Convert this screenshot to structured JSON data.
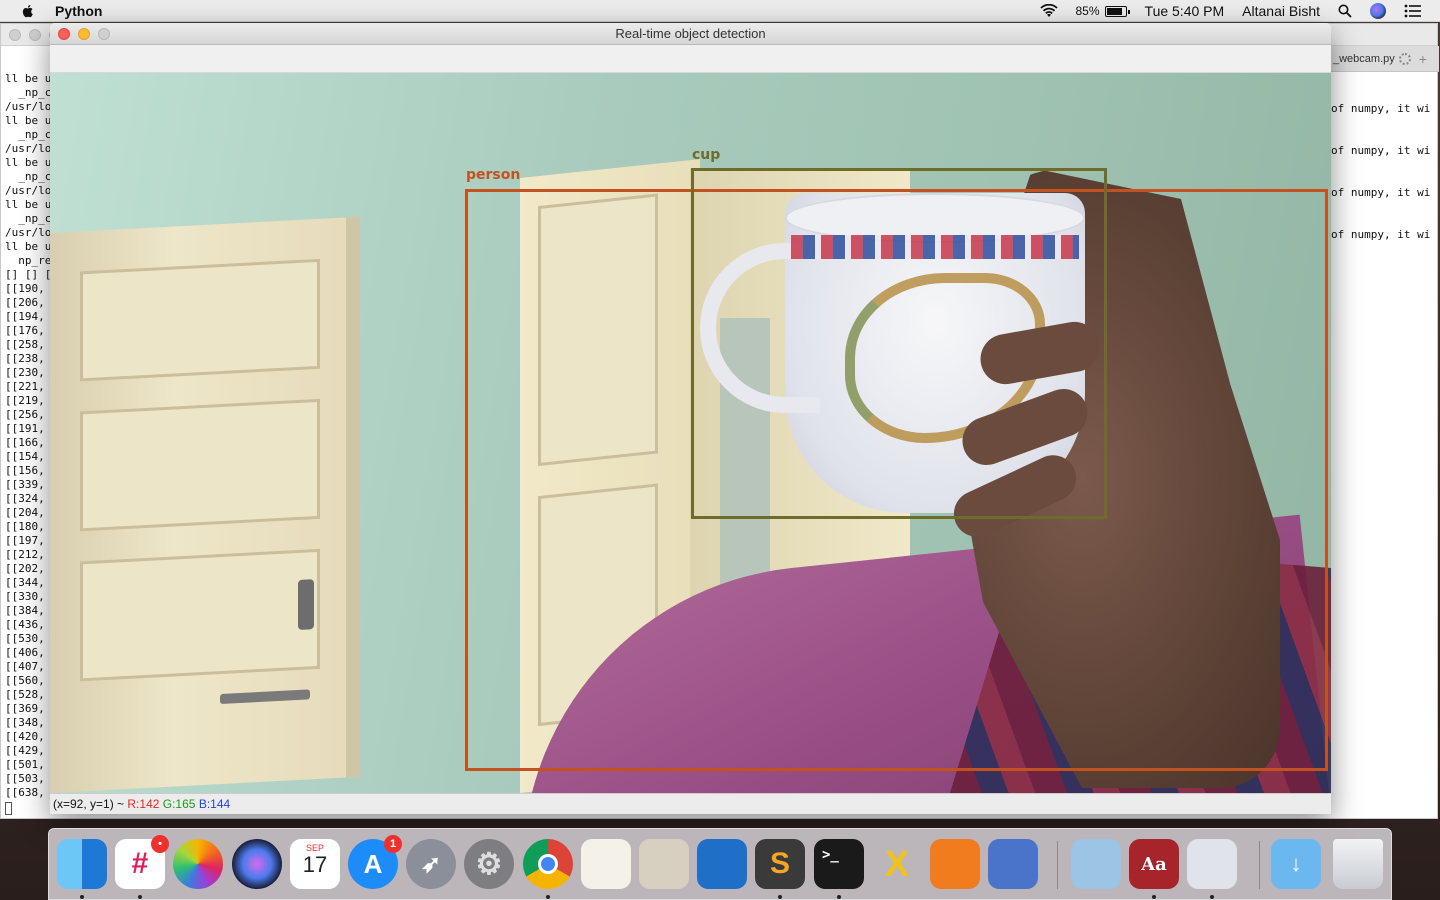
{
  "menubar": {
    "app_name": "Python",
    "battery_percent": "85%",
    "clock": "Tue 5:40 PM",
    "user_name": "Altanai Bisht"
  },
  "terminal": {
    "tab_title": "_webcam.py",
    "left_lines": [
      "ll be u",
      "  _np_c",
      "/usr/lo",
      "ll be u",
      "  _np_c",
      "/usr/lo",
      "ll be u",
      "  _np_c",
      "/usr/lo",
      "ll be u",
      "  _np_c",
      "/usr/lo",
      "ll be u",
      "  np_re",
      "[] [] [",
      "[[190,",
      "[[206,",
      "[[194,",
      "[[176,",
      "[[258,",
      "[[238,",
      "[[230,",
      "[[221,",
      "[[219,",
      "[[256,",
      "[[191,",
      "[[166,",
      "[[154,",
      "[[156,",
      "[[339,",
      "[[324,",
      "[[204,",
      "[[180,",
      "[[197,",
      "[[212,",
      "[[202,",
      "[[344,",
      "[[330,",
      "[[384,",
      "[[436,",
      "[[530,",
      "[[406,",
      "[[407,",
      "[[560,",
      "[[528,",
      "[[369,",
      "[[348,",
      "[[420,",
      "[[429,",
      "[[501,",
      "[[503,",
      "[[638,"
    ],
    "right_lines": [
      "of numpy, it wi",
      "",
      "",
      "of numpy, it wi",
      "",
      "",
      "of numpy, it wi",
      "",
      "",
      "of numpy, it wi"
    ]
  },
  "detection_window": {
    "title": "Real-time object detection",
    "detections": [
      {
        "label": "person",
        "color": "#c4521f"
      },
      {
        "label": "cup",
        "color": "#6f6b2b"
      }
    ],
    "status": {
      "coords": "(x=92, y=1) ~",
      "r": "R:142",
      "g": "G:165",
      "b": "B:144"
    }
  },
  "dock": {
    "items": [
      {
        "name": "Finder",
        "icon": "finder-icon",
        "color": "#3a8ee6",
        "running": true
      },
      {
        "name": "Slack",
        "icon": "slack-icon",
        "color": "#ffffff",
        "running": true,
        "badge": "•"
      },
      {
        "name": "Photos",
        "icon": "photos-icon",
        "color": "#ffffff",
        "running": false
      },
      {
        "name": "Siri",
        "icon": "siri-icon",
        "color": "#1c1c2e",
        "running": false
      },
      {
        "name": "Calendar",
        "icon": "calendar-icon",
        "color": "#ffffff",
        "running": false,
        "month": "SEP",
        "day": "17"
      },
      {
        "name": "App Store",
        "icon": "app-store-icon",
        "color": "#1d8cf8",
        "running": false,
        "badge": "1"
      },
      {
        "name": "Launchpad",
        "icon": "launchpad-icon",
        "color": "#8a8f99",
        "running": false
      },
      {
        "name": "System Preferences",
        "icon": "gear-icon",
        "color": "#7d7d82",
        "running": false
      },
      {
        "name": "Chrome",
        "icon": "chrome-icon",
        "color": "#ffffff",
        "running": true
      },
      {
        "name": "TextEdit",
        "icon": "textedit-icon",
        "color": "#f4f1e8",
        "running": false
      },
      {
        "name": "Keychain Access",
        "icon": "keychain-icon",
        "color": "#d7d0c0",
        "running": false
      },
      {
        "name": "Wireshark",
        "icon": "wireshark-icon",
        "color": "#1f6fc9",
        "running": false
      },
      {
        "name": "Sublime Text",
        "icon": "sublime-icon",
        "color": "#3a3a3a",
        "running": true
      },
      {
        "name": "Terminal",
        "icon": "terminal-icon",
        "color": "#1a1a1a",
        "running": true
      },
      {
        "name": "XQuartz",
        "icon": "xquartz-icon",
        "color": "#f2c316",
        "running": false
      },
      {
        "name": "Postman",
        "icon": "postman-icon",
        "color": "#f07c1e",
        "running": false
      },
      {
        "name": "Python Launcher",
        "icon": "python-launcher-icon",
        "color": "#4a74c9",
        "running": false
      },
      {
        "name": "Preview",
        "icon": "preview-icon",
        "color": "#9cc4e4",
        "running": false
      },
      {
        "name": "Dictionary",
        "icon": "dictionary-icon",
        "color": "#a6242a",
        "running": true
      },
      {
        "name": "Python Rocket",
        "icon": "rocket-icon",
        "color": "#e0e4ea",
        "running": true
      },
      {
        "name": "Downloads",
        "icon": "downloads-folder-icon",
        "color": "#6bb8f0",
        "running": false
      },
      {
        "name": "Trash",
        "icon": "trash-icon",
        "color": "#dadde2",
        "running": false
      }
    ]
  }
}
